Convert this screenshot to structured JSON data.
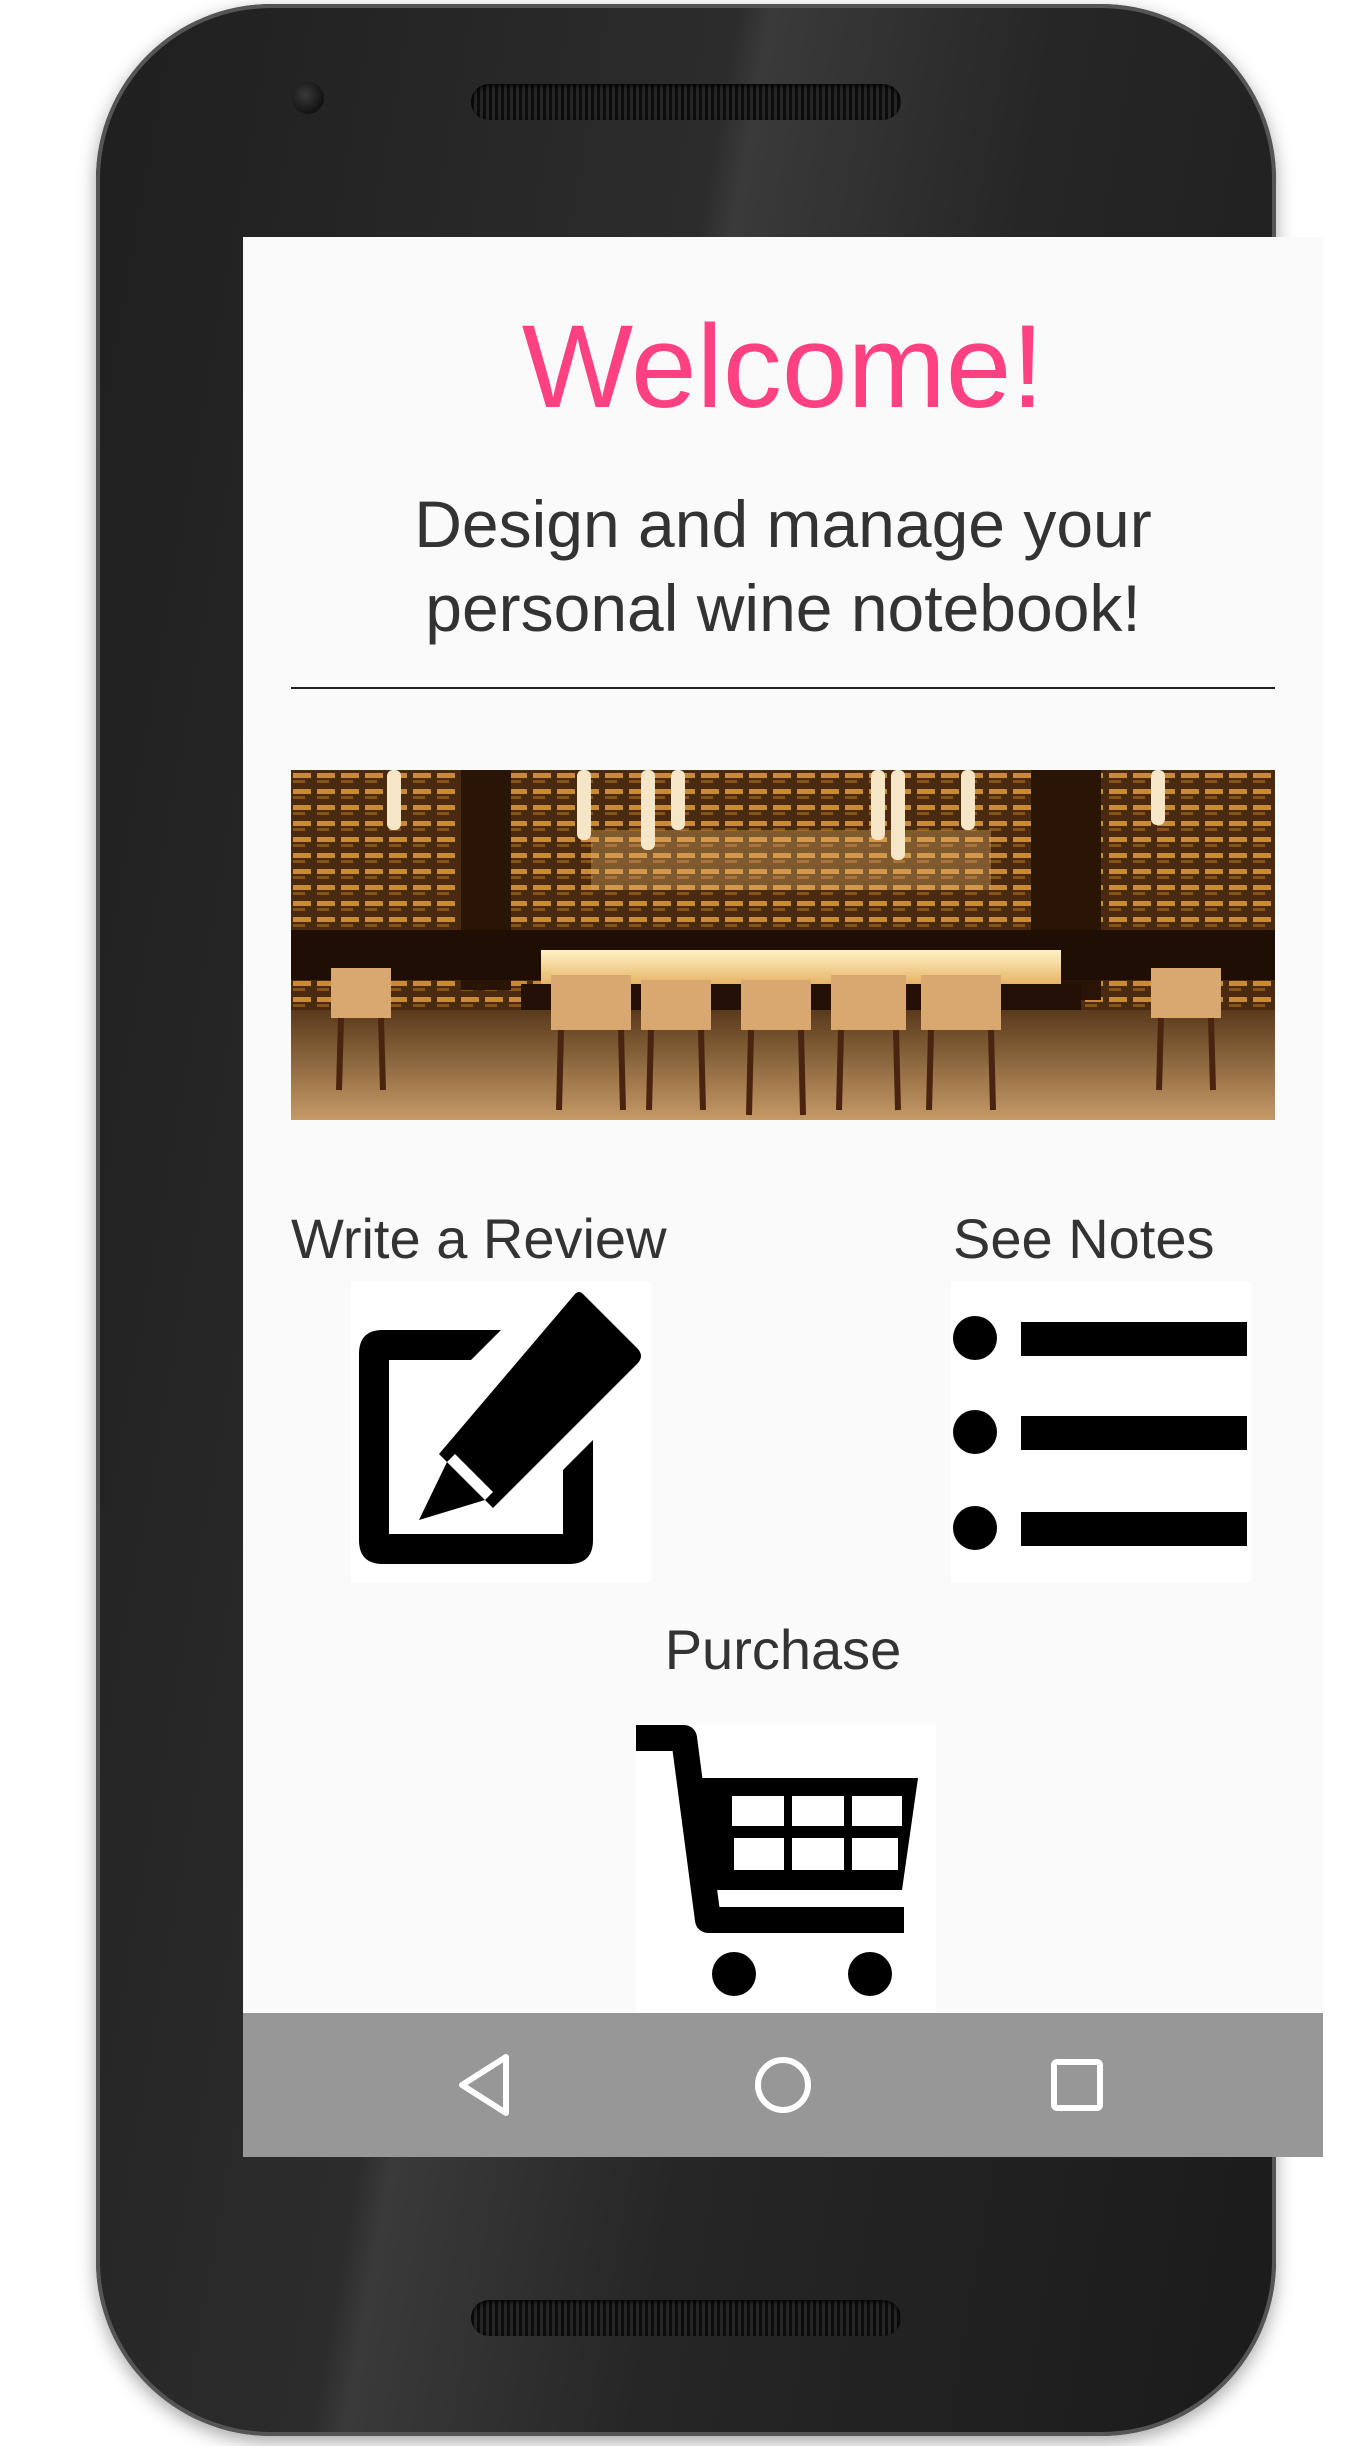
{
  "header": {
    "title": "Welcome!",
    "subtitle_line1": "Design and manage your",
    "subtitle_line2": "personal wine notebook!"
  },
  "hero_image": {
    "description": "wine bar interior"
  },
  "actions": {
    "review": {
      "label": "Write a Review",
      "icon": "edit-icon"
    },
    "notes": {
      "label": "See Notes",
      "icon": "list-icon"
    },
    "purchase": {
      "label": "Purchase",
      "icon": "cart-icon"
    }
  },
  "navbar": {
    "back": "back-icon",
    "home": "home-icon",
    "recents": "recents-icon"
  },
  "colors": {
    "accent": "#ff4081",
    "text": "#333333",
    "screen_bg": "#fafafa",
    "navbar_bg": "#979797"
  }
}
